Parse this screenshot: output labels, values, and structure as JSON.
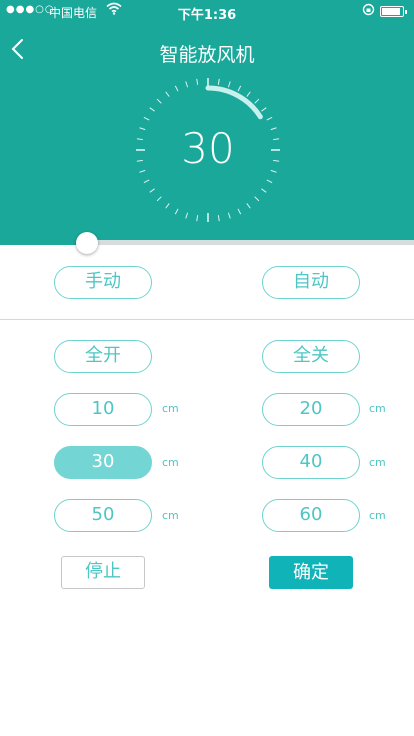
{
  "status_bar": {
    "signal": "●●●○○",
    "carrier": "中国电信",
    "time": "下午1:36"
  },
  "header": {
    "title": "智能放风机",
    "back_icon": "chevron-left-icon"
  },
  "dial": {
    "value": "30",
    "progress_fraction": 0.16
  },
  "slider": {
    "fraction": 0.21
  },
  "mode": {
    "manual": "手动",
    "auto": "自动"
  },
  "controls": {
    "all_open": "全开",
    "all_close": "全关"
  },
  "presets": [
    {
      "value": "10",
      "unit": "cm",
      "active": false
    },
    {
      "value": "20",
      "unit": "cm",
      "active": false
    },
    {
      "value": "30",
      "unit": "cm",
      "active": true
    },
    {
      "value": "40",
      "unit": "cm",
      "active": false
    },
    {
      "value": "50",
      "unit": "cm",
      "active": false
    },
    {
      "value": "60",
      "unit": "cm",
      "active": false
    }
  ],
  "actions": {
    "stop": "停止",
    "confirm": "确定"
  },
  "colors": {
    "header_bg": "#1aa89a",
    "accent": "#4ec6c3",
    "pill_border": "#6fd3d0",
    "active_pill": "#74d6d4",
    "confirm_bg": "#0fb3b8"
  }
}
